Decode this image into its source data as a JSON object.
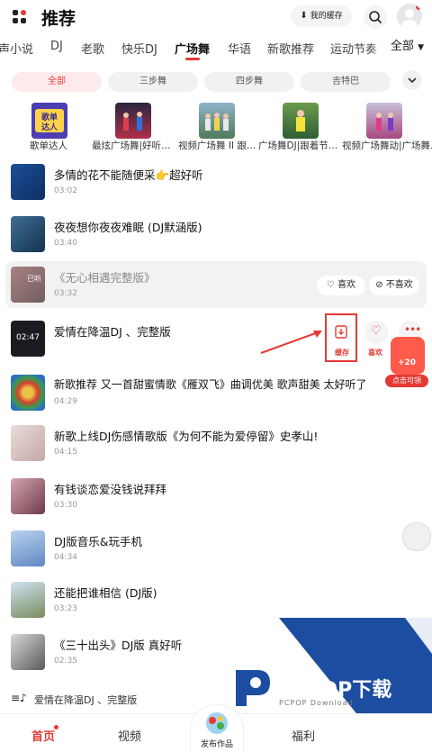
{
  "header": {
    "title": "推荐",
    "cache_label": "我的缓存"
  },
  "categories": [
    "声小说",
    "DJ",
    "老歌",
    "快乐DJ",
    "广场舞",
    "华语",
    "新歌推荐",
    "运动节奏"
  ],
  "categories_active_index": 4,
  "all_dropdown": "全部",
  "sub_tabs": [
    "全部",
    "三步舞",
    "四步舞",
    "吉特巴"
  ],
  "playlists": [
    {
      "label": "歌单达人",
      "cover_text": "歌单\n达人"
    },
    {
      "label": "最炫广场舞|好听…"
    },
    {
      "label": "视频广场舞 II 跟…"
    },
    {
      "label": "广场舞DJ|跟着节…"
    },
    {
      "label": "视频广场舞动|广场舞…"
    }
  ],
  "songs": [
    {
      "title": "多情的花不能随便采👉超好听",
      "duration": "03:02"
    },
    {
      "title": "夜夜想你夜夜难眠 (DJ默涵版)",
      "duration": "03:40"
    },
    {
      "title": "《无心相遇完整版》",
      "duration": "03:32",
      "badge": "已听"
    },
    {
      "title": "爱情在降温DJ 、完整版",
      "duration": "",
      "thumb_text": "02:47"
    },
    {
      "title": "新歌推荐 又一首甜蜜情歌《雁双飞》曲调优美 歌声甜美 太好听了",
      "duration": "04:29"
    },
    {
      "title": "新歌上线DJ伤感情歌版《为何不能为爱停留》史孝山!",
      "duration": "04:15"
    },
    {
      "title": "有钱谈恋爱没钱说拜拜",
      "duration": "03:30"
    },
    {
      "title": "DJ版音乐&玩手机",
      "duration": "04:34"
    },
    {
      "title": "还能把谁相信 (DJ版)",
      "duration": "03:23"
    },
    {
      "title": "《三十出头》DJ版 真好听",
      "duration": "02:35"
    }
  ],
  "highlight_actions": {
    "like": "喜欢",
    "dislike": "不喜欢"
  },
  "row_actions": {
    "download": "缓存",
    "like": "喜欢"
  },
  "promo": {
    "amount": "+20",
    "label": "点击可领"
  },
  "mini_player": {
    "title": "爱情在降温DJ 、完整版"
  },
  "nav": {
    "home": "首页",
    "video": "视频",
    "publish": "发布作品",
    "welfare": "福利"
  },
  "watermark": {
    "brand": "PCPOP下载",
    "sub": "PCPOP Download"
  },
  "colors": {
    "accent": "#e53935",
    "watermark_blue": "#1c4da1"
  }
}
